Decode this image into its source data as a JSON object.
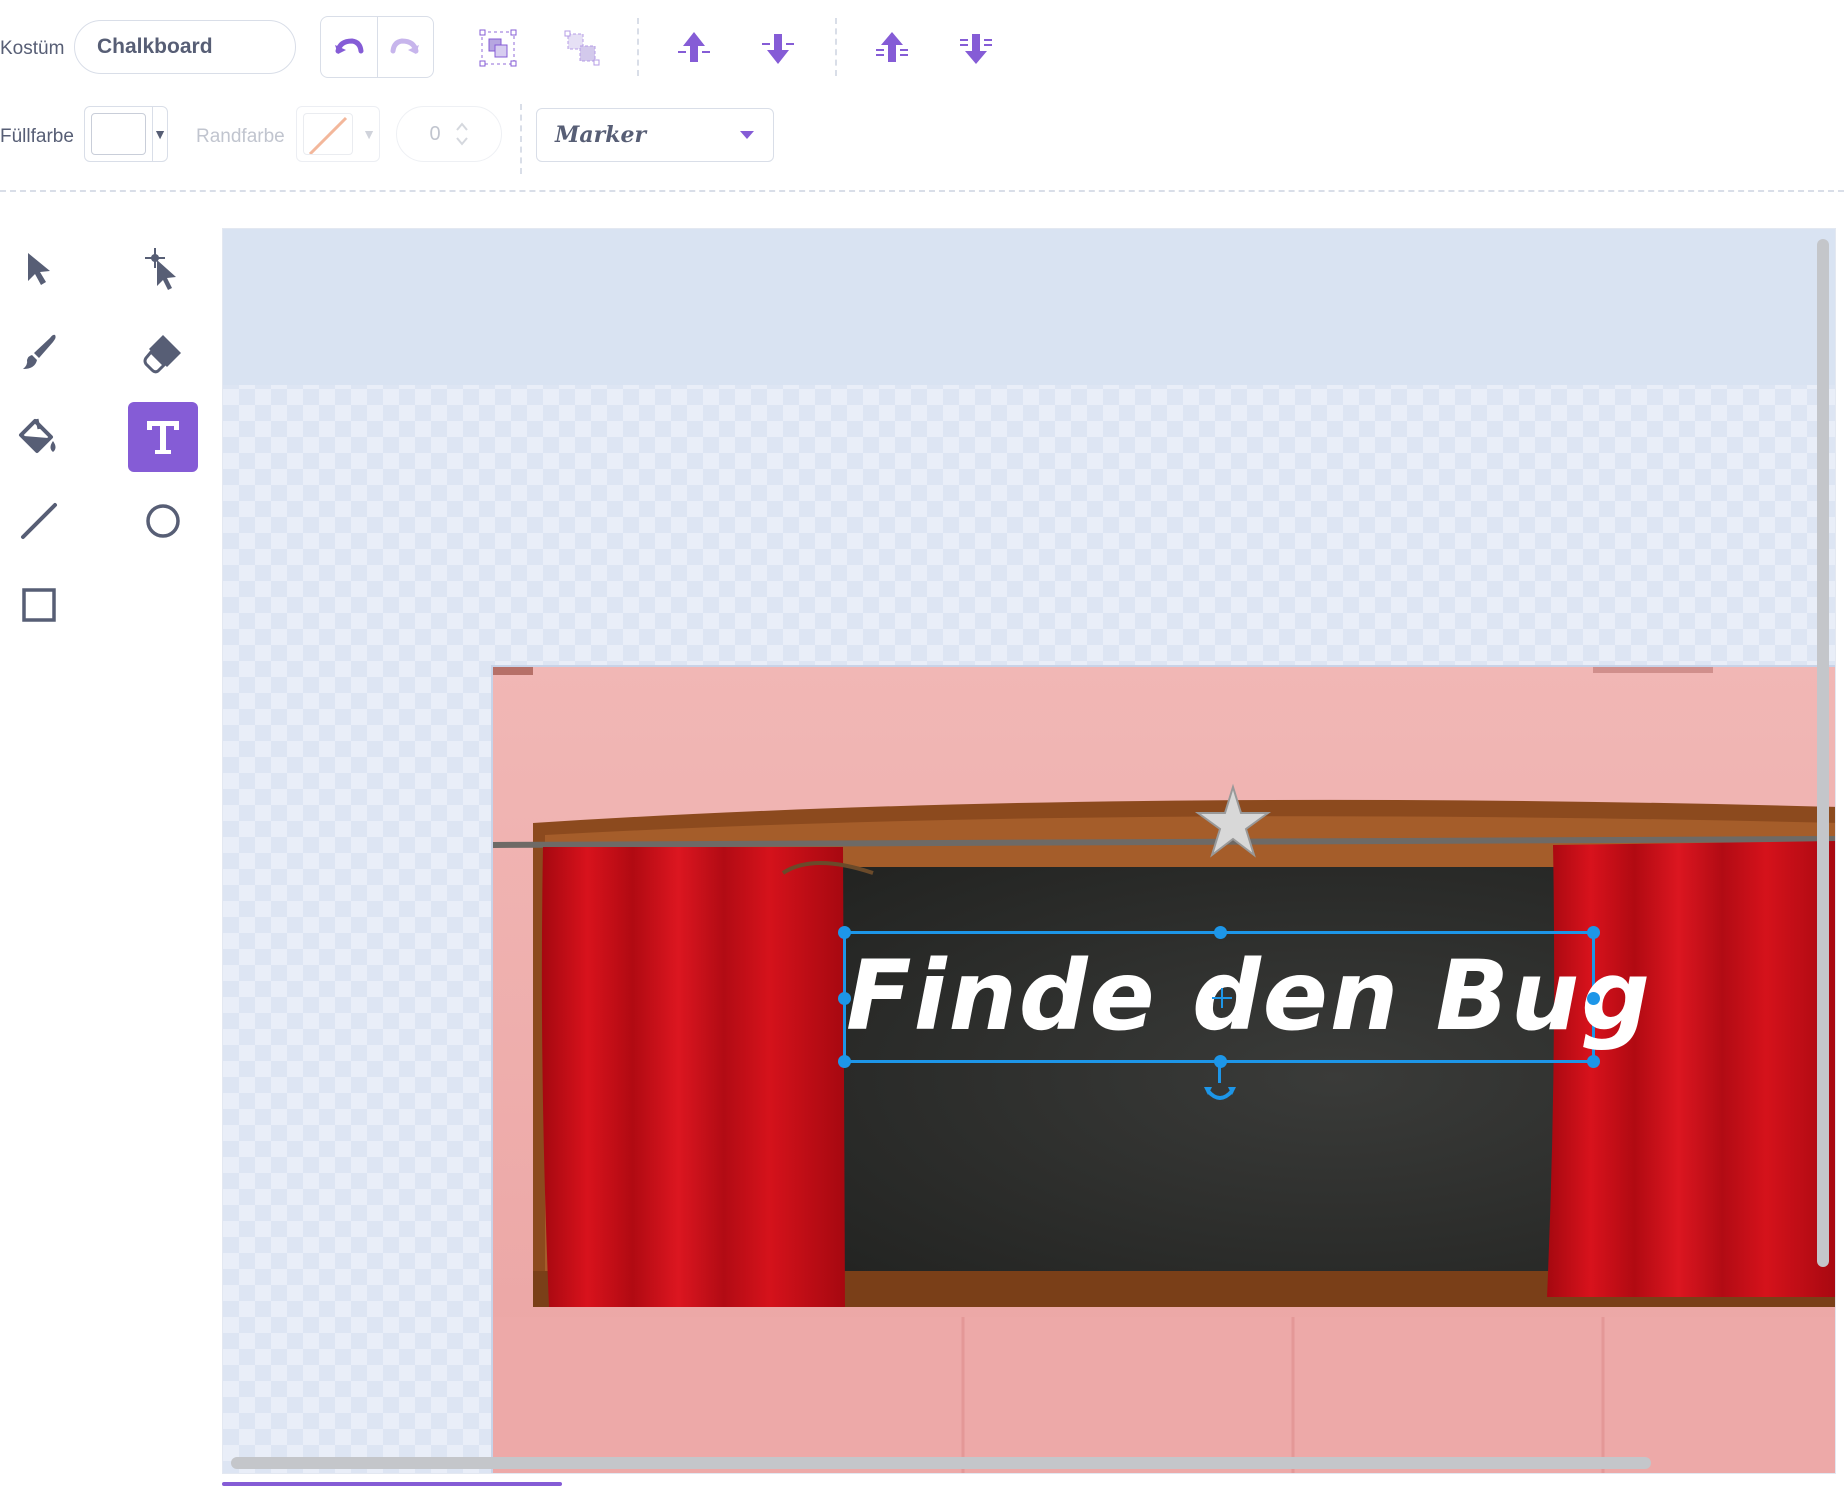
{
  "toolbar": {
    "costume_label": "Kostüm",
    "costume_name": "Chalkboard",
    "fill_label": "Füllfarbe",
    "outline_label": "Randfarbe",
    "outline_width": "0",
    "font_name": "Marker",
    "buttons": [
      "undo-icon",
      "redo-icon",
      "group-icon",
      "ungroup-icon",
      "forward-icon",
      "backward-icon",
      "front-icon",
      "back-icon"
    ]
  },
  "tools": [
    "select",
    "reshape",
    "brush",
    "eraser",
    "fill",
    "text",
    "line",
    "circle",
    "rectangle"
  ],
  "active_tool": "text",
  "canvas": {
    "text_element": "Finde den Bug"
  },
  "colors": {
    "accent": "#855cd6",
    "selection": "#1d96e8",
    "text_gray": "#575e75",
    "wall_pink": "#efa9a8",
    "curtain_red": "#c8101a",
    "chalkboard": "#2c2d2b"
  }
}
